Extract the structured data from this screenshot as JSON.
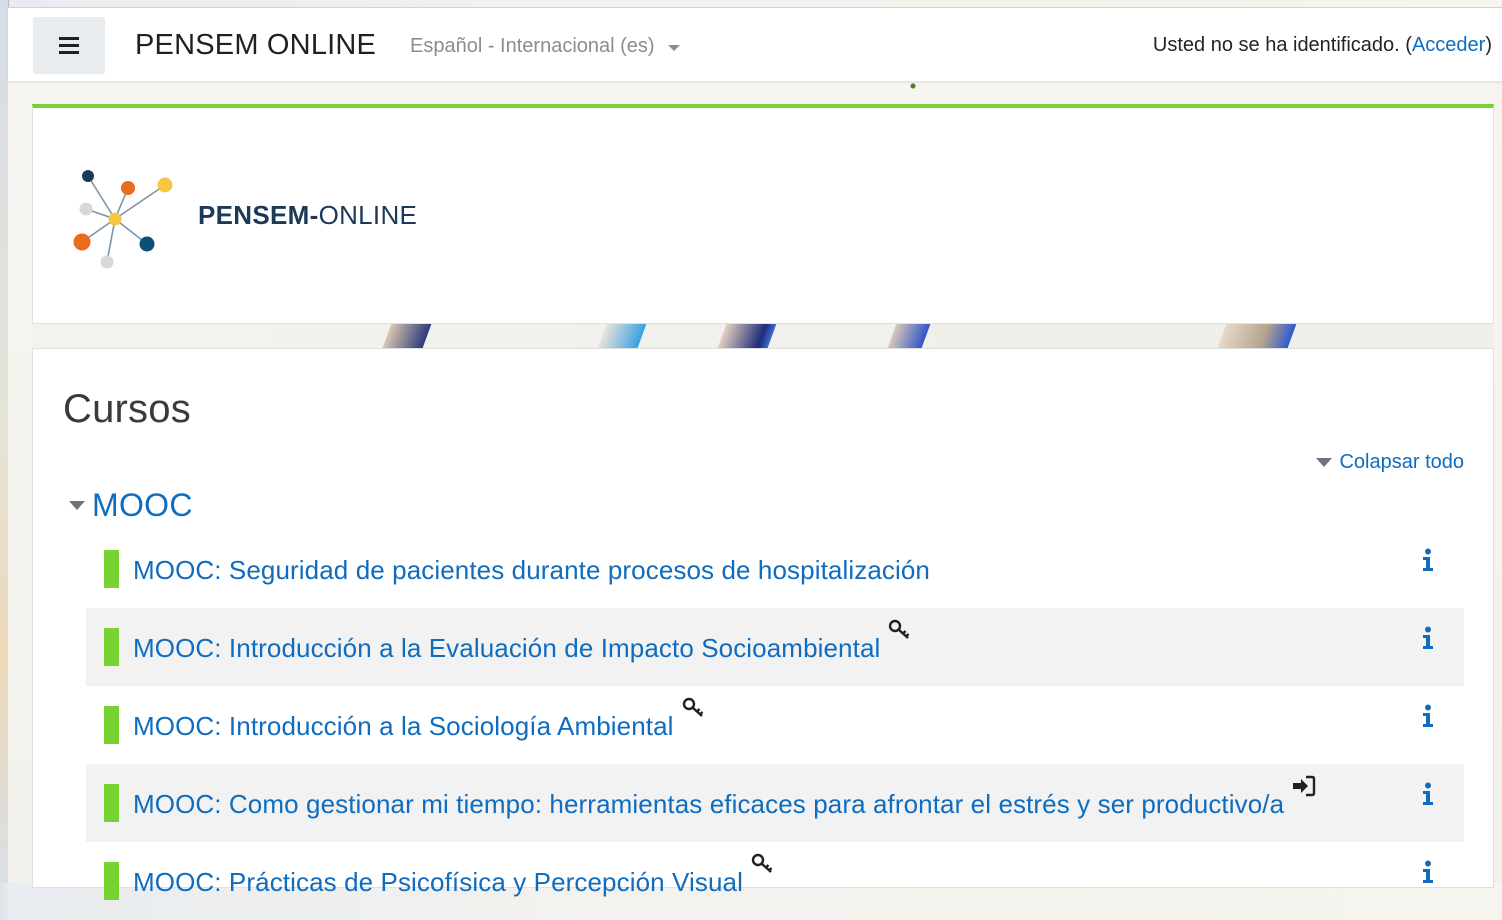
{
  "navbar": {
    "site_name": "PENSEM ONLINE",
    "language": "Español - Internacional (es)",
    "login_text": "Usted no se ha identificado. (",
    "login_link": "Acceder",
    "login_close": ")"
  },
  "header": {
    "logo_bold": "PENSEM-",
    "logo_light": "ONLINE"
  },
  "courses": {
    "title": "Cursos",
    "collapse_all": "Colapsar todo",
    "category": "MOOC",
    "items": [
      {
        "title": "MOOC: Seguridad de pacientes durante procesos de hospitalización",
        "enrol_icon": "none"
      },
      {
        "title": "MOOC: Introducción a la Evaluación de Impacto Socioambiental",
        "enrol_icon": "key-icon"
      },
      {
        "title": "MOOC: Introducción a la Sociología Ambiental",
        "enrol_icon": "key-icon"
      },
      {
        "title": "MOOC: Como gestionar mi tiempo: herramientas eficaces para afrontar el estrés y ser productivo/a",
        "enrol_icon": "sign-in-icon"
      },
      {
        "title": "MOOC: Prácticas de Psicofísica y Percepción Visual",
        "enrol_icon": "key-icon"
      }
    ]
  },
  "colors": {
    "accent_green": "#76d332",
    "link_blue": "#0f6cbf",
    "logo_navy": "#1c3a57"
  }
}
